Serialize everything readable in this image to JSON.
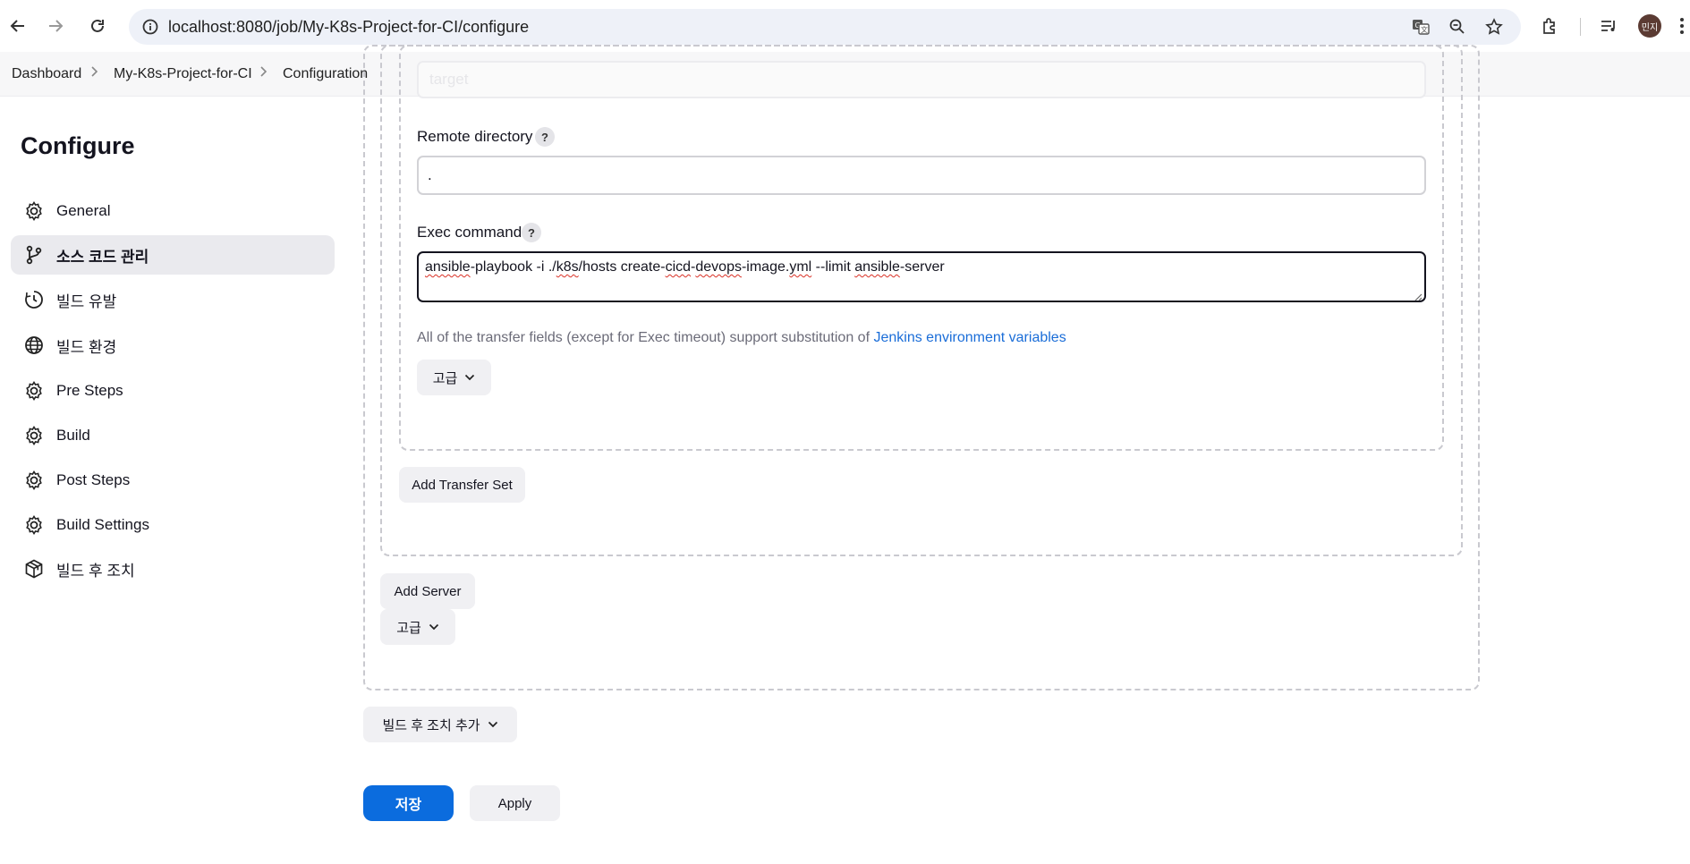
{
  "browser": {
    "url": "localhost:8080/job/My-K8s-Project-for-CI/configure",
    "avatar_text": "민지",
    "icons": [
      "back-arrow-icon",
      "forward-arrow-icon",
      "reload-icon",
      "site-info-icon",
      "translate-icon",
      "zoom-icon",
      "bookmark-star-icon",
      "extensions-icon",
      "media-playlist-icon",
      "profile-avatar",
      "more-menu-icon"
    ]
  },
  "breadcrumb": {
    "items": [
      "Dashboard",
      "My-K8s-Project-for-CI",
      "Configuration"
    ]
  },
  "sidebar": {
    "title": "Configure",
    "items": [
      {
        "label": "General",
        "icon": "gear-icon",
        "active": false
      },
      {
        "label": "소스 코드 관리",
        "icon": "source-branch-icon",
        "active": true
      },
      {
        "label": "빌드 유발",
        "icon": "clock-trigger-icon",
        "active": false
      },
      {
        "label": "빌드 환경",
        "icon": "globe-icon",
        "active": false
      },
      {
        "label": "Pre Steps",
        "icon": "gear-icon",
        "active": false
      },
      {
        "label": "Build",
        "icon": "gear-icon",
        "active": false
      },
      {
        "label": "Post Steps",
        "icon": "gear-icon",
        "active": false
      },
      {
        "label": "Build Settings",
        "icon": "gear-icon",
        "active": false
      },
      {
        "label": "빌드 후 조치",
        "icon": "package-icon",
        "active": false
      }
    ]
  },
  "main": {
    "faded_field_value": "target",
    "remote_directory": {
      "label": "Remote directory",
      "value": "."
    },
    "exec_command": {
      "label": "Exec command",
      "value": "ansible-playbook -i ./k8s/hosts create-cicd-devops-image.yml --limit ansible-server"
    },
    "help_glyph": "?",
    "note_text": "All of the transfer fields (except for Exec timeout) support substitution of ",
    "note_link": "Jenkins environment variables",
    "advanced_label": "고급",
    "add_transfer_set": "Add Transfer Set",
    "add_server": "Add Server",
    "add_post_build": "빌드 후 조치 추가",
    "save": "저장",
    "apply": "Apply"
  },
  "colors": {
    "primary": "#0b6cde",
    "link": "#1a6dd8",
    "active_bg": "#eaeaee"
  }
}
